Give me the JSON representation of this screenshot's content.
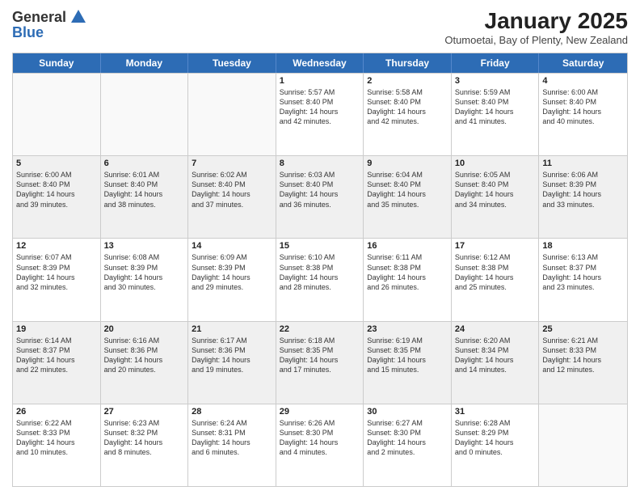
{
  "header": {
    "logo_general": "General",
    "logo_blue": "Blue",
    "month_title": "January 2025",
    "subtitle": "Otumoetai, Bay of Plenty, New Zealand"
  },
  "calendar": {
    "days_of_week": [
      "Sunday",
      "Monday",
      "Tuesday",
      "Wednesday",
      "Thursday",
      "Friday",
      "Saturday"
    ],
    "rows": [
      [
        {
          "day": "",
          "lines": [],
          "empty": true
        },
        {
          "day": "",
          "lines": [],
          "empty": true
        },
        {
          "day": "",
          "lines": [],
          "empty": true
        },
        {
          "day": "1",
          "lines": [
            "Sunrise: 5:57 AM",
            "Sunset: 8:40 PM",
            "Daylight: 14 hours",
            "and 42 minutes."
          ],
          "empty": false
        },
        {
          "day": "2",
          "lines": [
            "Sunrise: 5:58 AM",
            "Sunset: 8:40 PM",
            "Daylight: 14 hours",
            "and 42 minutes."
          ],
          "empty": false
        },
        {
          "day": "3",
          "lines": [
            "Sunrise: 5:59 AM",
            "Sunset: 8:40 PM",
            "Daylight: 14 hours",
            "and 41 minutes."
          ],
          "empty": false
        },
        {
          "day": "4",
          "lines": [
            "Sunrise: 6:00 AM",
            "Sunset: 8:40 PM",
            "Daylight: 14 hours",
            "and 40 minutes."
          ],
          "empty": false
        }
      ],
      [
        {
          "day": "5",
          "lines": [
            "Sunrise: 6:00 AM",
            "Sunset: 8:40 PM",
            "Daylight: 14 hours",
            "and 39 minutes."
          ],
          "empty": false
        },
        {
          "day": "6",
          "lines": [
            "Sunrise: 6:01 AM",
            "Sunset: 8:40 PM",
            "Daylight: 14 hours",
            "and 38 minutes."
          ],
          "empty": false
        },
        {
          "day": "7",
          "lines": [
            "Sunrise: 6:02 AM",
            "Sunset: 8:40 PM",
            "Daylight: 14 hours",
            "and 37 minutes."
          ],
          "empty": false
        },
        {
          "day": "8",
          "lines": [
            "Sunrise: 6:03 AM",
            "Sunset: 8:40 PM",
            "Daylight: 14 hours",
            "and 36 minutes."
          ],
          "empty": false
        },
        {
          "day": "9",
          "lines": [
            "Sunrise: 6:04 AM",
            "Sunset: 8:40 PM",
            "Daylight: 14 hours",
            "and 35 minutes."
          ],
          "empty": false
        },
        {
          "day": "10",
          "lines": [
            "Sunrise: 6:05 AM",
            "Sunset: 8:40 PM",
            "Daylight: 14 hours",
            "and 34 minutes."
          ],
          "empty": false
        },
        {
          "day": "11",
          "lines": [
            "Sunrise: 6:06 AM",
            "Sunset: 8:39 PM",
            "Daylight: 14 hours",
            "and 33 minutes."
          ],
          "empty": false
        }
      ],
      [
        {
          "day": "12",
          "lines": [
            "Sunrise: 6:07 AM",
            "Sunset: 8:39 PM",
            "Daylight: 14 hours",
            "and 32 minutes."
          ],
          "empty": false
        },
        {
          "day": "13",
          "lines": [
            "Sunrise: 6:08 AM",
            "Sunset: 8:39 PM",
            "Daylight: 14 hours",
            "and 30 minutes."
          ],
          "empty": false
        },
        {
          "day": "14",
          "lines": [
            "Sunrise: 6:09 AM",
            "Sunset: 8:39 PM",
            "Daylight: 14 hours",
            "and 29 minutes."
          ],
          "empty": false
        },
        {
          "day": "15",
          "lines": [
            "Sunrise: 6:10 AM",
            "Sunset: 8:38 PM",
            "Daylight: 14 hours",
            "and 28 minutes."
          ],
          "empty": false
        },
        {
          "day": "16",
          "lines": [
            "Sunrise: 6:11 AM",
            "Sunset: 8:38 PM",
            "Daylight: 14 hours",
            "and 26 minutes."
          ],
          "empty": false
        },
        {
          "day": "17",
          "lines": [
            "Sunrise: 6:12 AM",
            "Sunset: 8:38 PM",
            "Daylight: 14 hours",
            "and 25 minutes."
          ],
          "empty": false
        },
        {
          "day": "18",
          "lines": [
            "Sunrise: 6:13 AM",
            "Sunset: 8:37 PM",
            "Daylight: 14 hours",
            "and 23 minutes."
          ],
          "empty": false
        }
      ],
      [
        {
          "day": "19",
          "lines": [
            "Sunrise: 6:14 AM",
            "Sunset: 8:37 PM",
            "Daylight: 14 hours",
            "and 22 minutes."
          ],
          "empty": false
        },
        {
          "day": "20",
          "lines": [
            "Sunrise: 6:16 AM",
            "Sunset: 8:36 PM",
            "Daylight: 14 hours",
            "and 20 minutes."
          ],
          "empty": false
        },
        {
          "day": "21",
          "lines": [
            "Sunrise: 6:17 AM",
            "Sunset: 8:36 PM",
            "Daylight: 14 hours",
            "and 19 minutes."
          ],
          "empty": false
        },
        {
          "day": "22",
          "lines": [
            "Sunrise: 6:18 AM",
            "Sunset: 8:35 PM",
            "Daylight: 14 hours",
            "and 17 minutes."
          ],
          "empty": false
        },
        {
          "day": "23",
          "lines": [
            "Sunrise: 6:19 AM",
            "Sunset: 8:35 PM",
            "Daylight: 14 hours",
            "and 15 minutes."
          ],
          "empty": false
        },
        {
          "day": "24",
          "lines": [
            "Sunrise: 6:20 AM",
            "Sunset: 8:34 PM",
            "Daylight: 14 hours",
            "and 14 minutes."
          ],
          "empty": false
        },
        {
          "day": "25",
          "lines": [
            "Sunrise: 6:21 AM",
            "Sunset: 8:33 PM",
            "Daylight: 14 hours",
            "and 12 minutes."
          ],
          "empty": false
        }
      ],
      [
        {
          "day": "26",
          "lines": [
            "Sunrise: 6:22 AM",
            "Sunset: 8:33 PM",
            "Daylight: 14 hours",
            "and 10 minutes."
          ],
          "empty": false
        },
        {
          "day": "27",
          "lines": [
            "Sunrise: 6:23 AM",
            "Sunset: 8:32 PM",
            "Daylight: 14 hours",
            "and 8 minutes."
          ],
          "empty": false
        },
        {
          "day": "28",
          "lines": [
            "Sunrise: 6:24 AM",
            "Sunset: 8:31 PM",
            "Daylight: 14 hours",
            "and 6 minutes."
          ],
          "empty": false
        },
        {
          "day": "29",
          "lines": [
            "Sunrise: 6:26 AM",
            "Sunset: 8:30 PM",
            "Daylight: 14 hours",
            "and 4 minutes."
          ],
          "empty": false
        },
        {
          "day": "30",
          "lines": [
            "Sunrise: 6:27 AM",
            "Sunset: 8:30 PM",
            "Daylight: 14 hours",
            "and 2 minutes."
          ],
          "empty": false
        },
        {
          "day": "31",
          "lines": [
            "Sunrise: 6:28 AM",
            "Sunset: 8:29 PM",
            "Daylight: 14 hours",
            "and 0 minutes."
          ],
          "empty": false
        },
        {
          "day": "",
          "lines": [],
          "empty": true
        }
      ]
    ]
  }
}
